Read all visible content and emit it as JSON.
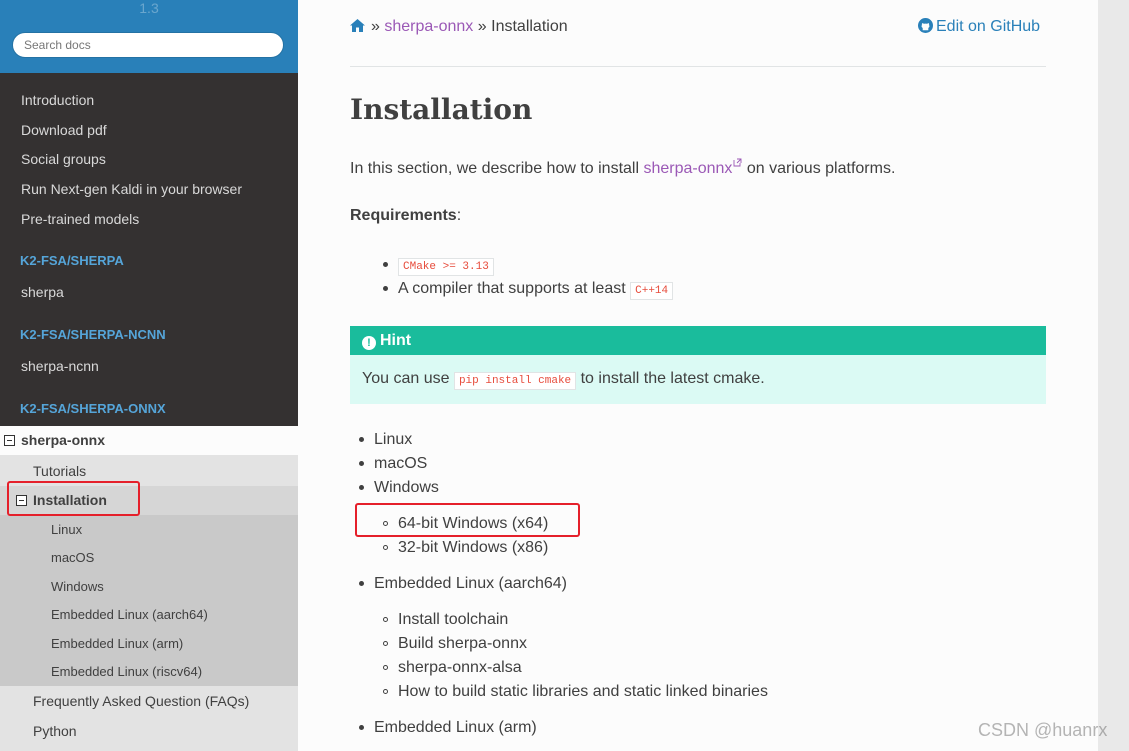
{
  "sidebar": {
    "version": "1.3",
    "search_placeholder": "Search docs",
    "nav_top": [
      "Introduction",
      "Download pdf",
      "Social groups",
      "Run Next-gen Kaldi in your browser",
      "Pre-trained models"
    ],
    "caption_sherpa": "K2-FSA/SHERPA",
    "item_sherpa": "sherpa",
    "caption_ncnn": "K2-FSA/SHERPA-NCNN",
    "item_ncnn": "sherpa-ncnn",
    "caption_onnx": "K2-FSA/SHERPA-ONNX",
    "current_l1": "sherpa-onnx",
    "l2_tutorials": "Tutorials",
    "l2_installation": "Installation",
    "l3_items": [
      "Linux",
      "macOS",
      "Windows",
      "Embedded Linux (aarch64)",
      "Embedded Linux (arm)",
      "Embedded Linux (riscv64)"
    ],
    "l2_after": [
      "Frequently Asked Question (FAQs)",
      "Python"
    ]
  },
  "breadcrumb": {
    "sep1": "»",
    "parent": "sherpa-onnx",
    "sep2": "»",
    "current": "Installation",
    "edit": "Edit on GitHub"
  },
  "content": {
    "title": "Installation",
    "intro_before": "In this section, we describe how to install ",
    "intro_link": "sherpa-onnx",
    "intro_after": " on various platforms.",
    "requirements": "Requirements",
    "req_colon": ":",
    "req_cmake": "CMake >= 3.13",
    "req_compiler": "A compiler that supports at least ",
    "req_cpp": "C++14",
    "hint_title": "Hint",
    "hint_before": "You can use ",
    "hint_code": "pip install cmake",
    "hint_after": " to install the latest cmake.",
    "toc_linux": "Linux",
    "toc_macos": "macOS",
    "toc_windows": "Windows",
    "toc_win64": "64-bit Windows (x64)",
    "toc_win32": "32-bit Windows (x86)",
    "toc_aarch64": "Embedded Linux (aarch64)",
    "toc_sub": [
      "Install toolchain",
      "Build sherpa-onnx",
      "sherpa-onnx-alsa",
      "How to build static libraries and static linked binaries"
    ],
    "toc_arm": "Embedded Linux (arm)"
  },
  "watermark": "CSDN @huanrx",
  "colors": {
    "accent_blue": "#2980b9",
    "visited_purple": "#9b59b6",
    "hint_green": "#1abc9c",
    "annotation_red": "#e5202b"
  }
}
